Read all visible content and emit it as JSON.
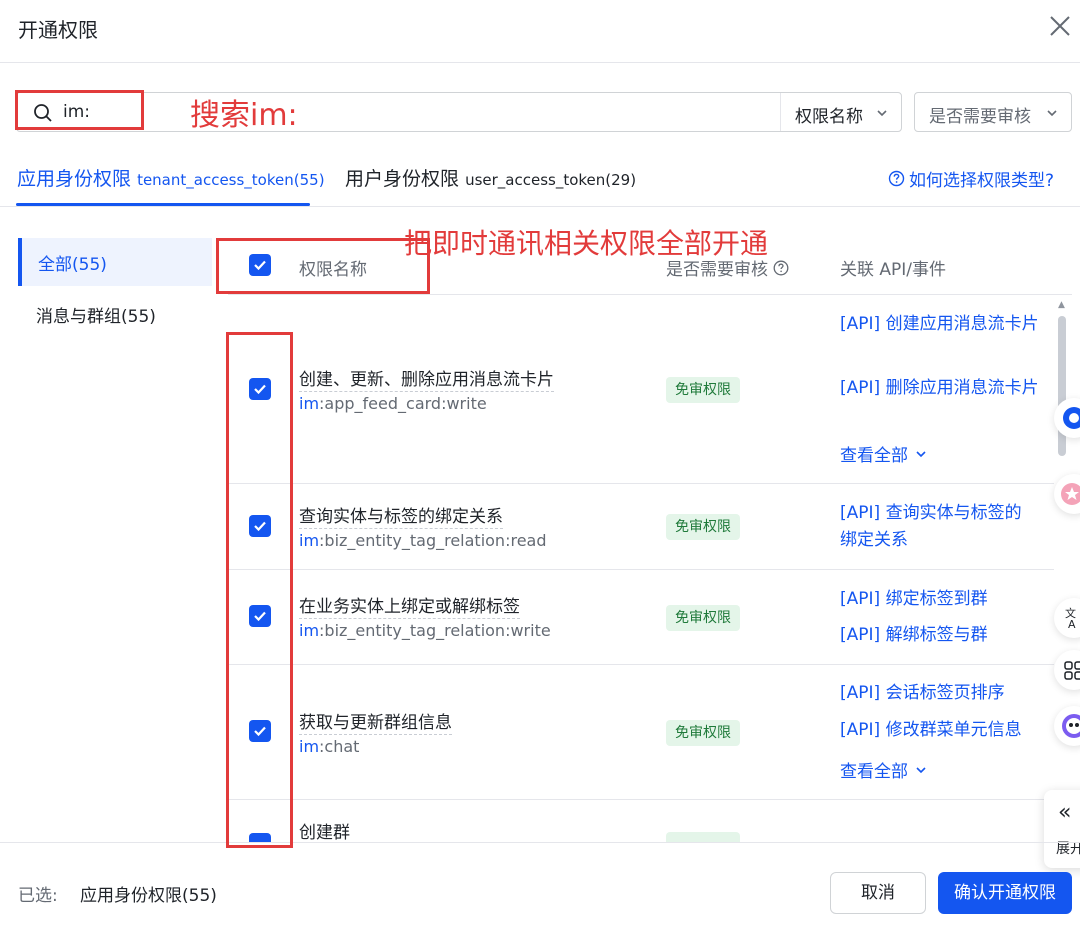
{
  "dialog": {
    "title": "开通权限"
  },
  "search": {
    "value": "im:"
  },
  "filters": {
    "name_filter": "权限名称",
    "review_filter": "是否需要审核"
  },
  "tabs": [
    {
      "label": "应用身份权限",
      "token": "tenant_access_token(55)"
    },
    {
      "label": "用户身份权限",
      "token": "user_access_token(29)"
    }
  ],
  "help_link": "如何选择权限类型?",
  "categories": [
    {
      "label": "全部(55)"
    },
    {
      "label": "消息与群组(55)"
    }
  ],
  "table": {
    "headers": {
      "name": "权限名称",
      "review": "是否需要审核",
      "api": "关联 API/事件"
    },
    "rows": [
      {
        "name": "创建、更新、删除应用消息流卡片",
        "scope_prefix": "im",
        "scope_rest": ":app_feed_card:write",
        "badge": "免审权限",
        "apis": [
          "[API] 创建应用消息流卡片",
          "[API] 删除应用消息流卡片"
        ],
        "view_all": "查看全部"
      },
      {
        "name": "查询实体与标签的绑定关系",
        "scope_prefix": "im",
        "scope_rest": ":biz_entity_tag_relation:read",
        "badge": "免审权限",
        "apis": [
          "[API] 查询实体与标签的绑定关系"
        ]
      },
      {
        "name": "在业务实体上绑定或解绑标签",
        "scope_prefix": "im",
        "scope_rest": ":biz_entity_tag_relation:write",
        "badge": "免审权限",
        "apis": [
          "[API] 绑定标签到群",
          "[API] 解绑标签与群"
        ]
      },
      {
        "name": "获取与更新群组信息",
        "scope_prefix": "im",
        "scope_rest": ":chat",
        "badge": "免审权限",
        "apis": [
          "[API] 会话标签页排序",
          "[API] 修改群菜单元信息"
        ],
        "view_all": "查看全部"
      },
      {
        "name": "创建群"
      }
    ]
  },
  "side_panel": {
    "expand_label": "展开"
  },
  "footer": {
    "selected_label": "已选:",
    "selected_value": "应用身份权限(55)",
    "cancel": "取消",
    "confirm": "确认开通权限"
  },
  "annotations": {
    "search_hint": "搜索im:",
    "enable_hint": "把即时通讯相关权限全部开通"
  },
  "colors": {
    "primary": "#1456f0",
    "annotation": "#e23b3b",
    "badge_bg": "#e4f5e9"
  }
}
